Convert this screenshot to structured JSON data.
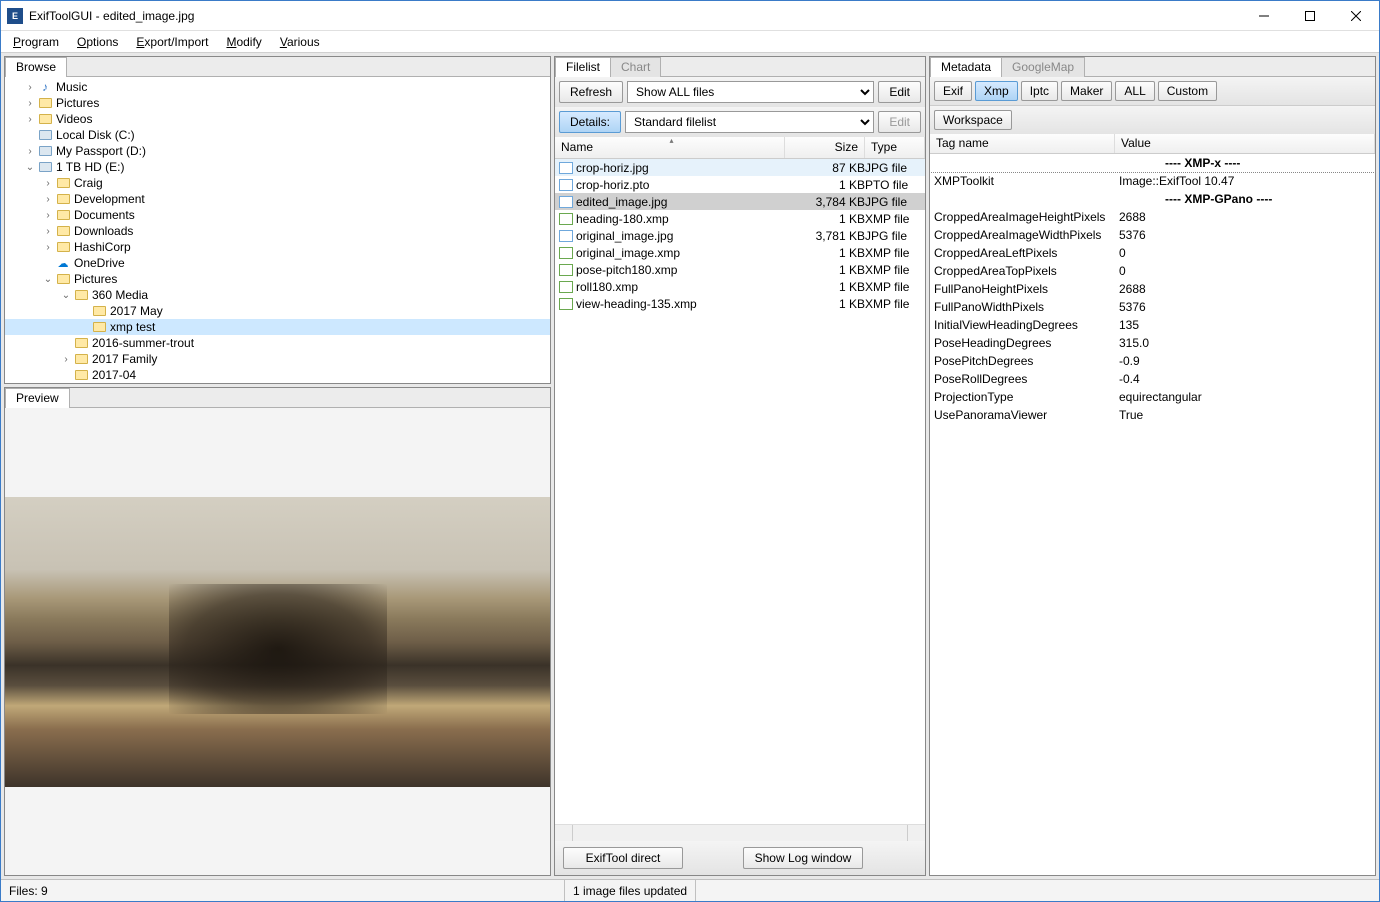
{
  "window": {
    "title": "ExifToolGUI - edited_image.jpg"
  },
  "menu": {
    "program": "Program",
    "options": "Options",
    "export": "Export/Import",
    "modify": "Modify",
    "various": "Various"
  },
  "tabs": {
    "browse": "Browse",
    "preview": "Preview",
    "filelist": "Filelist",
    "chart": "Chart",
    "metadata": "Metadata",
    "googlemap": "GoogleMap"
  },
  "tree": [
    {
      "indent": 1,
      "arrow": "›",
      "icon": "music",
      "label": "Music"
    },
    {
      "indent": 1,
      "arrow": "›",
      "icon": "folder-img",
      "label": "Pictures"
    },
    {
      "indent": 1,
      "arrow": "›",
      "icon": "folder-vid",
      "label": "Videos"
    },
    {
      "indent": 1,
      "arrow": "",
      "icon": "drive",
      "label": "Local Disk (C:)"
    },
    {
      "indent": 1,
      "arrow": "›",
      "icon": "drive",
      "label": "My Passport (D:)"
    },
    {
      "indent": 1,
      "arrow": "⌄",
      "icon": "drive",
      "label": "1 TB HD (E:)"
    },
    {
      "indent": 2,
      "arrow": "›",
      "icon": "folder",
      "label": "Craig"
    },
    {
      "indent": 2,
      "arrow": "›",
      "icon": "folder",
      "label": "Development"
    },
    {
      "indent": 2,
      "arrow": "›",
      "icon": "folder",
      "label": "Documents"
    },
    {
      "indent": 2,
      "arrow": "›",
      "icon": "folder",
      "label": "Downloads"
    },
    {
      "indent": 2,
      "arrow": "›",
      "icon": "folder",
      "label": "HashiCorp"
    },
    {
      "indent": 2,
      "arrow": "",
      "icon": "cloud",
      "label": "OneDrive"
    },
    {
      "indent": 2,
      "arrow": "⌄",
      "icon": "folder",
      "label": "Pictures"
    },
    {
      "indent": 3,
      "arrow": "⌄",
      "icon": "folder",
      "label": "360 Media"
    },
    {
      "indent": 4,
      "arrow": "",
      "icon": "folder",
      "label": "2017 May"
    },
    {
      "indent": 4,
      "arrow": "",
      "icon": "folder",
      "label": "xmp test",
      "sel": true
    },
    {
      "indent": 3,
      "arrow": "",
      "icon": "folder",
      "label": "2016-summer-trout"
    },
    {
      "indent": 3,
      "arrow": "›",
      "icon": "folder",
      "label": "2017 Family"
    },
    {
      "indent": 3,
      "arrow": "",
      "icon": "folder",
      "label": "2017-04"
    }
  ],
  "toolbar": {
    "refresh": "Refresh",
    "details": "Details:",
    "edit": "Edit",
    "filter_value": "Show ALL files",
    "view_value": "Standard filelist"
  },
  "filelist": {
    "cols": {
      "name": "Name",
      "size": "Size",
      "type": "Type"
    },
    "rows": [
      {
        "name": "crop-horiz.jpg",
        "size": "87 KB",
        "type": "JPG file",
        "icon": "jpg",
        "hl": true
      },
      {
        "name": "crop-horiz.pto",
        "size": "1 KB",
        "type": "PTO file",
        "icon": "jpg"
      },
      {
        "name": "edited_image.jpg",
        "size": "3,784 KB",
        "type": "JPG file",
        "icon": "jpg",
        "sel": true
      },
      {
        "name": "heading-180.xmp",
        "size": "1 KB",
        "type": "XMP file",
        "icon": "xmp"
      },
      {
        "name": "original_image.jpg",
        "size": "3,781 KB",
        "type": "JPG file",
        "icon": "jpg"
      },
      {
        "name": "original_image.xmp",
        "size": "1 KB",
        "type": "XMP file",
        "icon": "xmp"
      },
      {
        "name": "pose-pitch180.xmp",
        "size": "1 KB",
        "type": "XMP file",
        "icon": "xmp"
      },
      {
        "name": "roll180.xmp",
        "size": "1 KB",
        "type": "XMP file",
        "icon": "xmp"
      },
      {
        "name": "view-heading-135.xmp",
        "size": "1 KB",
        "type": "XMP file",
        "icon": "xmp"
      }
    ]
  },
  "bottombtns": {
    "direct": "ExifTool direct",
    "log": "Show Log window"
  },
  "metabtns": {
    "exif": "Exif",
    "xmp": "Xmp",
    "iptc": "Iptc",
    "maker": "Maker",
    "all": "ALL",
    "custom": "Custom",
    "workspace": "Workspace"
  },
  "metacols": {
    "tag": "Tag name",
    "value": "Value"
  },
  "metadata": [
    {
      "tag": "",
      "value": "---- XMP-x ----",
      "section": true,
      "boxed": true
    },
    {
      "tag": "XMPToolkit",
      "value": "Image::ExifTool 10.47"
    },
    {
      "tag": "",
      "value": "---- XMP-GPano ----",
      "section": true
    },
    {
      "tag": "CroppedAreaImageHeightPixels",
      "value": "2688"
    },
    {
      "tag": "CroppedAreaImageWidthPixels",
      "value": "5376"
    },
    {
      "tag": "CroppedAreaLeftPixels",
      "value": "0"
    },
    {
      "tag": "CroppedAreaTopPixels",
      "value": "0"
    },
    {
      "tag": "FullPanoHeightPixels",
      "value": "2688"
    },
    {
      "tag": "FullPanoWidthPixels",
      "value": "5376"
    },
    {
      "tag": "InitialViewHeadingDegrees",
      "value": "135"
    },
    {
      "tag": "PoseHeadingDegrees",
      "value": "315.0"
    },
    {
      "tag": "PosePitchDegrees",
      "value": "-0.9"
    },
    {
      "tag": "PoseRollDegrees",
      "value": "-0.4"
    },
    {
      "tag": "ProjectionType",
      "value": "equirectangular"
    },
    {
      "tag": "UsePanoramaViewer",
      "value": "True"
    }
  ],
  "status": {
    "left": "Files: 9",
    "right": "1 image files updated"
  }
}
